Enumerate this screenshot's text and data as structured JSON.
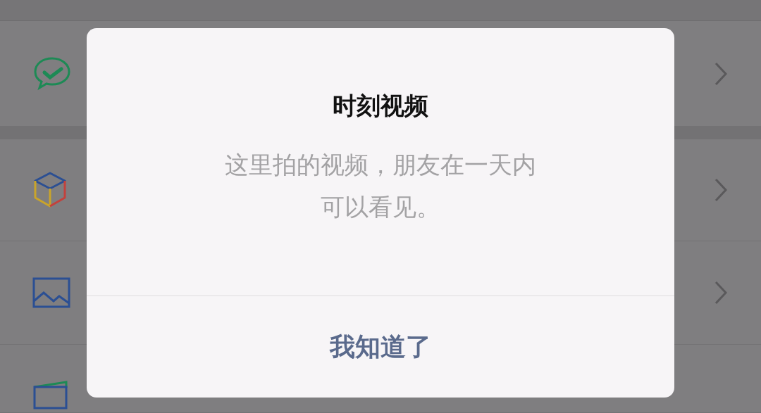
{
  "list": [
    {
      "kind": "moments"
    },
    {
      "kind": "cube"
    },
    {
      "kind": "photo"
    },
    {
      "kind": "wallet"
    }
  ],
  "dialog": {
    "title": "时刻视频",
    "message_lines": [
      "这里拍的视频，朋友在一天内",
      "可以看见。"
    ],
    "button": "我知道了"
  }
}
